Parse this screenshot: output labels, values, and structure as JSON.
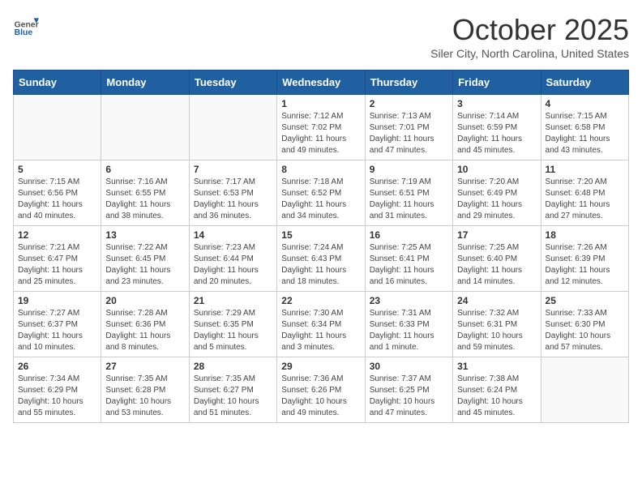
{
  "header": {
    "logo_general": "General",
    "logo_blue": "Blue",
    "month_title": "October 2025",
    "subtitle": "Siler City, North Carolina, United States"
  },
  "days_of_week": [
    "Sunday",
    "Monday",
    "Tuesday",
    "Wednesday",
    "Thursday",
    "Friday",
    "Saturday"
  ],
  "weeks": [
    [
      {
        "day": "",
        "info": ""
      },
      {
        "day": "",
        "info": ""
      },
      {
        "day": "",
        "info": ""
      },
      {
        "day": "1",
        "info": "Sunrise: 7:12 AM\nSunset: 7:02 PM\nDaylight: 11 hours and 49 minutes."
      },
      {
        "day": "2",
        "info": "Sunrise: 7:13 AM\nSunset: 7:01 PM\nDaylight: 11 hours and 47 minutes."
      },
      {
        "day": "3",
        "info": "Sunrise: 7:14 AM\nSunset: 6:59 PM\nDaylight: 11 hours and 45 minutes."
      },
      {
        "day": "4",
        "info": "Sunrise: 7:15 AM\nSunset: 6:58 PM\nDaylight: 11 hours and 43 minutes."
      }
    ],
    [
      {
        "day": "5",
        "info": "Sunrise: 7:15 AM\nSunset: 6:56 PM\nDaylight: 11 hours and 40 minutes."
      },
      {
        "day": "6",
        "info": "Sunrise: 7:16 AM\nSunset: 6:55 PM\nDaylight: 11 hours and 38 minutes."
      },
      {
        "day": "7",
        "info": "Sunrise: 7:17 AM\nSunset: 6:53 PM\nDaylight: 11 hours and 36 minutes."
      },
      {
        "day": "8",
        "info": "Sunrise: 7:18 AM\nSunset: 6:52 PM\nDaylight: 11 hours and 34 minutes."
      },
      {
        "day": "9",
        "info": "Sunrise: 7:19 AM\nSunset: 6:51 PM\nDaylight: 11 hours and 31 minutes."
      },
      {
        "day": "10",
        "info": "Sunrise: 7:20 AM\nSunset: 6:49 PM\nDaylight: 11 hours and 29 minutes."
      },
      {
        "day": "11",
        "info": "Sunrise: 7:20 AM\nSunset: 6:48 PM\nDaylight: 11 hours and 27 minutes."
      }
    ],
    [
      {
        "day": "12",
        "info": "Sunrise: 7:21 AM\nSunset: 6:47 PM\nDaylight: 11 hours and 25 minutes."
      },
      {
        "day": "13",
        "info": "Sunrise: 7:22 AM\nSunset: 6:45 PM\nDaylight: 11 hours and 23 minutes."
      },
      {
        "day": "14",
        "info": "Sunrise: 7:23 AM\nSunset: 6:44 PM\nDaylight: 11 hours and 20 minutes."
      },
      {
        "day": "15",
        "info": "Sunrise: 7:24 AM\nSunset: 6:43 PM\nDaylight: 11 hours and 18 minutes."
      },
      {
        "day": "16",
        "info": "Sunrise: 7:25 AM\nSunset: 6:41 PM\nDaylight: 11 hours and 16 minutes."
      },
      {
        "day": "17",
        "info": "Sunrise: 7:25 AM\nSunset: 6:40 PM\nDaylight: 11 hours and 14 minutes."
      },
      {
        "day": "18",
        "info": "Sunrise: 7:26 AM\nSunset: 6:39 PM\nDaylight: 11 hours and 12 minutes."
      }
    ],
    [
      {
        "day": "19",
        "info": "Sunrise: 7:27 AM\nSunset: 6:37 PM\nDaylight: 11 hours and 10 minutes."
      },
      {
        "day": "20",
        "info": "Sunrise: 7:28 AM\nSunset: 6:36 PM\nDaylight: 11 hours and 8 minutes."
      },
      {
        "day": "21",
        "info": "Sunrise: 7:29 AM\nSunset: 6:35 PM\nDaylight: 11 hours and 5 minutes."
      },
      {
        "day": "22",
        "info": "Sunrise: 7:30 AM\nSunset: 6:34 PM\nDaylight: 11 hours and 3 minutes."
      },
      {
        "day": "23",
        "info": "Sunrise: 7:31 AM\nSunset: 6:33 PM\nDaylight: 11 hours and 1 minute."
      },
      {
        "day": "24",
        "info": "Sunrise: 7:32 AM\nSunset: 6:31 PM\nDaylight: 10 hours and 59 minutes."
      },
      {
        "day": "25",
        "info": "Sunrise: 7:33 AM\nSunset: 6:30 PM\nDaylight: 10 hours and 57 minutes."
      }
    ],
    [
      {
        "day": "26",
        "info": "Sunrise: 7:34 AM\nSunset: 6:29 PM\nDaylight: 10 hours and 55 minutes."
      },
      {
        "day": "27",
        "info": "Sunrise: 7:35 AM\nSunset: 6:28 PM\nDaylight: 10 hours and 53 minutes."
      },
      {
        "day": "28",
        "info": "Sunrise: 7:35 AM\nSunset: 6:27 PM\nDaylight: 10 hours and 51 minutes."
      },
      {
        "day": "29",
        "info": "Sunrise: 7:36 AM\nSunset: 6:26 PM\nDaylight: 10 hours and 49 minutes."
      },
      {
        "day": "30",
        "info": "Sunrise: 7:37 AM\nSunset: 6:25 PM\nDaylight: 10 hours and 47 minutes."
      },
      {
        "day": "31",
        "info": "Sunrise: 7:38 AM\nSunset: 6:24 PM\nDaylight: 10 hours and 45 minutes."
      },
      {
        "day": "",
        "info": ""
      }
    ]
  ]
}
